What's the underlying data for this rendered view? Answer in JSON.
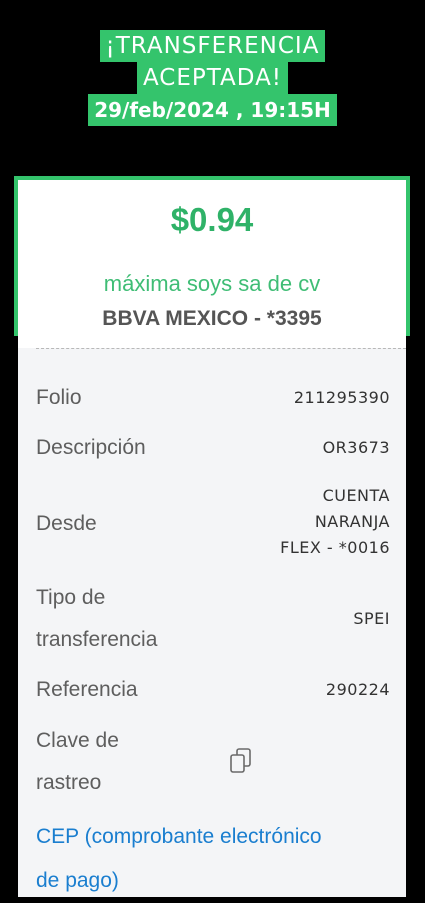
{
  "header": {
    "line1": "¡TRANSFERENCIA",
    "line2": "ACEPTADA!",
    "datetime": "29/feb/2024 , 19:15H"
  },
  "summary": {
    "amount": "$0.94",
    "recipient": "máxima soys sa de cv",
    "bank": "BBVA MEXICO - *3395"
  },
  "details": {
    "folio_label": "Folio",
    "folio_value": "211295390",
    "descripcion_label": "Descripción",
    "descripcion_value": "OR3673",
    "desde_label": "Desde",
    "desde_value_1": "CUENTA",
    "desde_value_2": "NARANJA",
    "desde_value_3": "FLEX - *0016",
    "tipo_label_1": "Tipo de",
    "tipo_label_2": "transferencia",
    "tipo_value": "SPEI",
    "referencia_label": "Referencia",
    "referencia_value": "290224",
    "clave_label_1": "Clave de",
    "clave_label_2": "rastreo",
    "copy_icon": "copy-icon"
  },
  "cep": {
    "line1": "CEP (comprobante electrónico",
    "line2": "de pago)"
  },
  "colors": {
    "accent_green": "#34c46c",
    "link_blue": "#1a7ecf"
  }
}
